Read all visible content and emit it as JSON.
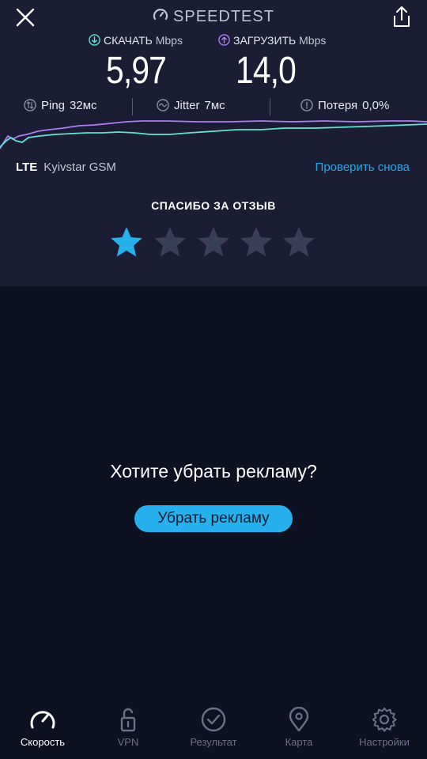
{
  "app": {
    "title": "SPEEDTEST"
  },
  "header": {
    "close_icon": "close-icon",
    "share_icon": "share-icon"
  },
  "download": {
    "label": "СКАЧАТЬ",
    "unit": "Mbps",
    "value": "5,97",
    "color": "#5fe3d4"
  },
  "upload": {
    "label": "ЗАГРУЗИТЬ",
    "unit": "Mbps",
    "value": "14,0",
    "color": "#b07cf0"
  },
  "metrics": {
    "ping": {
      "label": "Ping",
      "value": "32мс"
    },
    "jitter": {
      "label": "Jitter",
      "value": "7мс"
    },
    "loss": {
      "label": "Потеря",
      "value": "0,0%"
    }
  },
  "connection": {
    "type": "LTE",
    "provider": "Kyivstar GSM"
  },
  "retest_label": "Проверить снова",
  "feedback": {
    "title": "СПАСИБО ЗА ОТЗЫВ",
    "rating": 1,
    "max": 5
  },
  "ad": {
    "question": "Хотите убрать рекламу?",
    "button": "Убрать рекламу"
  },
  "nav": [
    {
      "label": "Скорость",
      "icon": "speed-gauge-icon",
      "active": true
    },
    {
      "label": "VPN",
      "icon": "lock-icon",
      "active": false
    },
    {
      "label": "Результат",
      "icon": "check-circle-icon",
      "active": false
    },
    {
      "label": "Карта",
      "icon": "map-pin-icon",
      "active": false
    },
    {
      "label": "Настройки",
      "icon": "gear-icon",
      "active": false
    }
  ],
  "colors": {
    "accent": "#27b0ee",
    "star_active": "#27b0ee",
    "star_inactive": "#3a3f58"
  }
}
